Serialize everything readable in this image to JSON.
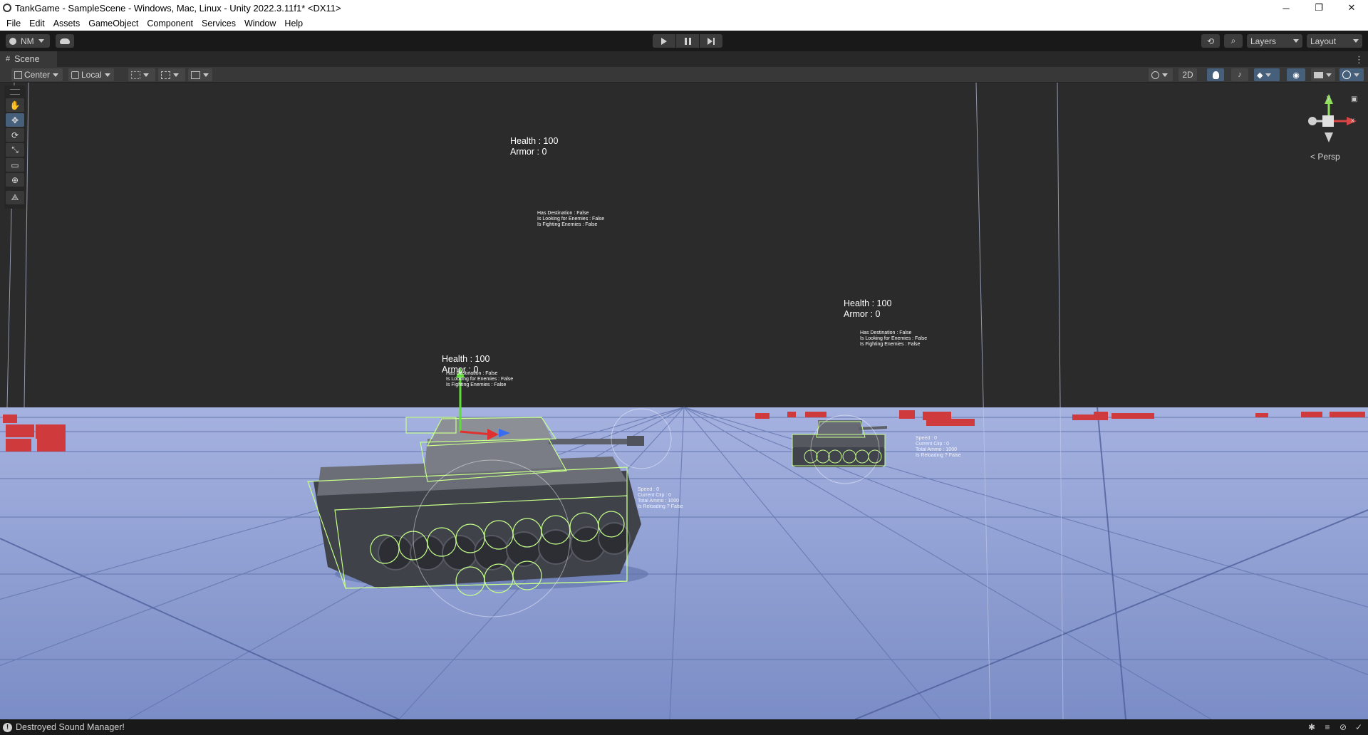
{
  "window": {
    "title": "TankGame - SampleScene - Windows, Mac, Linux - Unity 2022.3.11f1* <DX11>",
    "controls": {
      "minimize": "─",
      "restore": "❐",
      "close": "✕"
    }
  },
  "menu": [
    "File",
    "Edit",
    "Assets",
    "GameObject",
    "Component",
    "Services",
    "Window",
    "Help"
  ],
  "toolbar": {
    "account_label": "NM",
    "layers_label": "Layers",
    "layout_label": "Layout",
    "history_icon": "⟲",
    "search_icon": "⌕"
  },
  "scene_tab": {
    "label": "Scene",
    "menu_icon": "⋮"
  },
  "scene_toolbar": {
    "pivot_label": "Center",
    "space_label": "Local",
    "mode_2d_label": "2D"
  },
  "tools": [
    {
      "name": "hand-tool",
      "glyph": "✋"
    },
    {
      "name": "move-tool",
      "glyph": "✥",
      "active": true
    },
    {
      "name": "rotate-tool",
      "glyph": "⟳"
    },
    {
      "name": "scale-tool",
      "glyph": "⤡"
    },
    {
      "name": "rect-tool",
      "glyph": "▭"
    },
    {
      "name": "transform-tool",
      "glyph": "⊕"
    },
    {
      "name": "custom-tool",
      "glyph": "⟁"
    }
  ],
  "gizmo": {
    "y_label": "y",
    "x_label": "x",
    "persp_label": "< Persp"
  },
  "overlays": {
    "tank_far_top": {
      "health": "Health : 100",
      "armor": "Armor : 0",
      "ai": [
        "Has Destination : False",
        "Is Looking for Enemies  : False",
        "Is Fighting Enemies : False"
      ]
    },
    "tank_right": {
      "health": "Health : 100",
      "armor": "Armor : 0",
      "ai": [
        "Has Destination : False",
        "Is Looking for Enemies  : False",
        "Is Fighting Enemies : False"
      ],
      "weapon": [
        "Speed : 0",
        "Current Clip : 0",
        "Total Ammo : 1000",
        "Is Reloading ? False"
      ]
    },
    "tank_main": {
      "health": "Health : 100",
      "armor": "Armor : 0",
      "ai": [
        "Has Destination : False",
        "Is Looking for Enemies  : False",
        "Is Fighting Enemies : False"
      ],
      "weapon": [
        "Speed : 0",
        "Current Clip : 0",
        "Total Ammo : 1000",
        "Is Reloading ? False"
      ]
    }
  },
  "status": {
    "message": "Destroyed Sound Manager!",
    "icon": "!"
  },
  "colors": {
    "sky": "#2b2b2b",
    "ground": "#8293c9",
    "grid_line": "#5f70a8",
    "wireframe": "#c6ff8a",
    "crate": "#d0363a",
    "move_y": "#5fdc3a",
    "move_x": "#e03030",
    "move_z": "#3a6cf0"
  }
}
